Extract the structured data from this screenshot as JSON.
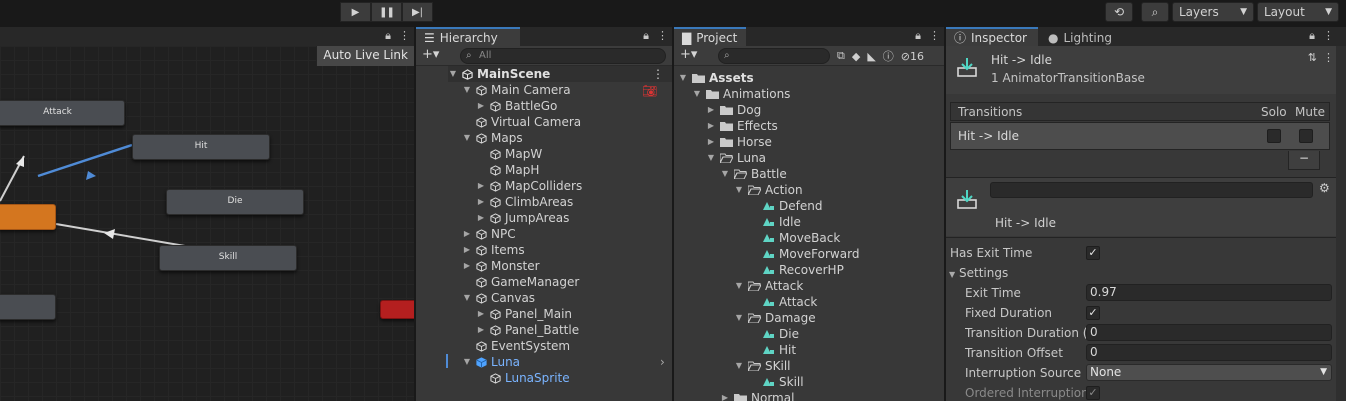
{
  "toolbar": {
    "layers_label": "Layers",
    "layout_label": "Layout"
  },
  "animator": {
    "live_link_label": "Auto Live Link",
    "nodes": [
      "Attack",
      "Hit",
      "Die",
      "Skill"
    ],
    "colors": {
      "state": "#4a4d52",
      "default_state": "#d4761f",
      "any_state": "#b41f1f",
      "selected_transition": "#4f8bd6"
    }
  },
  "hierarchy": {
    "tab_label": "Hierarchy",
    "search_placeholder": "All",
    "scene": "MainScene",
    "items": [
      {
        "label": "Main Camera",
        "depth": 1,
        "arrow": "open"
      },
      {
        "label": "BattleGo",
        "depth": 2,
        "arrow": "closed"
      },
      {
        "label": "Virtual Camera",
        "depth": 1,
        "arrow": ""
      },
      {
        "label": "Maps",
        "depth": 1,
        "arrow": "open"
      },
      {
        "label": "MapW",
        "depth": 2,
        "arrow": ""
      },
      {
        "label": "MapH",
        "depth": 2,
        "arrow": ""
      },
      {
        "label": "MapColliders",
        "depth": 2,
        "arrow": "closed"
      },
      {
        "label": "ClimbAreas",
        "depth": 2,
        "arrow": "closed"
      },
      {
        "label": "JumpAreas",
        "depth": 2,
        "arrow": "closed"
      },
      {
        "label": "NPC",
        "depth": 1,
        "arrow": "closed"
      },
      {
        "label": "Items",
        "depth": 1,
        "arrow": "closed"
      },
      {
        "label": "Monster",
        "depth": 1,
        "arrow": "closed"
      },
      {
        "label": "GameManager",
        "depth": 1,
        "arrow": ""
      },
      {
        "label": "Canvas",
        "depth": 1,
        "arrow": "open"
      },
      {
        "label": "Panel_Main",
        "depth": 2,
        "arrow": "closed"
      },
      {
        "label": "Panel_Battle",
        "depth": 2,
        "arrow": "closed"
      },
      {
        "label": "EventSystem",
        "depth": 1,
        "arrow": ""
      },
      {
        "label": "Luna",
        "depth": 1,
        "arrow": "open"
      },
      {
        "label": "LunaSprite",
        "depth": 2,
        "arrow": ""
      }
    ]
  },
  "project": {
    "tab_label": "Project",
    "hidden_count": "16",
    "items": [
      {
        "label": "Assets",
        "depth": 0,
        "arrow": "open",
        "kind": "folder"
      },
      {
        "label": "Animations",
        "depth": 1,
        "arrow": "open",
        "kind": "folder"
      },
      {
        "label": "Dog",
        "depth": 2,
        "arrow": "closed",
        "kind": "folder"
      },
      {
        "label": "Effects",
        "depth": 2,
        "arrow": "closed",
        "kind": "folder"
      },
      {
        "label": "Horse",
        "depth": 2,
        "arrow": "closed",
        "kind": "folder"
      },
      {
        "label": "Luna",
        "depth": 2,
        "arrow": "open",
        "kind": "folder-open"
      },
      {
        "label": "Battle",
        "depth": 3,
        "arrow": "open",
        "kind": "folder-open"
      },
      {
        "label": "Action",
        "depth": 4,
        "arrow": "open",
        "kind": "folder-open"
      },
      {
        "label": "Defend",
        "depth": 5,
        "arrow": "",
        "kind": "anim"
      },
      {
        "label": "Idle",
        "depth": 5,
        "arrow": "",
        "kind": "anim"
      },
      {
        "label": "MoveBack",
        "depth": 5,
        "arrow": "",
        "kind": "anim"
      },
      {
        "label": "MoveForward",
        "depth": 5,
        "arrow": "",
        "kind": "anim"
      },
      {
        "label": "RecoverHP",
        "depth": 5,
        "arrow": "",
        "kind": "anim"
      },
      {
        "label": "Attack",
        "depth": 4,
        "arrow": "open",
        "kind": "folder-open"
      },
      {
        "label": "Attack",
        "depth": 5,
        "arrow": "",
        "kind": "anim"
      },
      {
        "label": "Damage",
        "depth": 4,
        "arrow": "open",
        "kind": "folder-open"
      },
      {
        "label": "Die",
        "depth": 5,
        "arrow": "",
        "kind": "anim"
      },
      {
        "label": "Hit",
        "depth": 5,
        "arrow": "",
        "kind": "anim"
      },
      {
        "label": "SKill",
        "depth": 4,
        "arrow": "open",
        "kind": "folder-open"
      },
      {
        "label": "Skill",
        "depth": 5,
        "arrow": "",
        "kind": "anim"
      },
      {
        "label": "Normal",
        "depth": 3,
        "arrow": "closed",
        "kind": "folder"
      }
    ]
  },
  "inspector": {
    "tab_label": "Inspector",
    "lighting_tab_label": "Lighting",
    "title": "Hit -> Idle",
    "subtitle": "1 AnimatorTransitionBase",
    "transitions_header": "Transitions",
    "solo_label": "Solo",
    "mute_label": "Mute",
    "transition_row": "Hit -> Idle",
    "minus_label": "−",
    "name_field": "",
    "transition_name": "Hit -> Idle",
    "has_exit_time_label": "Has Exit Time",
    "settings_label": "Settings",
    "exit_time_label": "Exit Time",
    "exit_time_value": "0.97",
    "fixed_duration_label": "Fixed Duration",
    "transition_duration_label": "Transition Duration (s",
    "transition_duration_value": "0",
    "transition_offset_label": "Transition Offset",
    "transition_offset_value": "0",
    "interruption_source_label": "Interruption Source",
    "interruption_source_value": "None",
    "ordered_interruption_label": "Ordered Interruption"
  }
}
